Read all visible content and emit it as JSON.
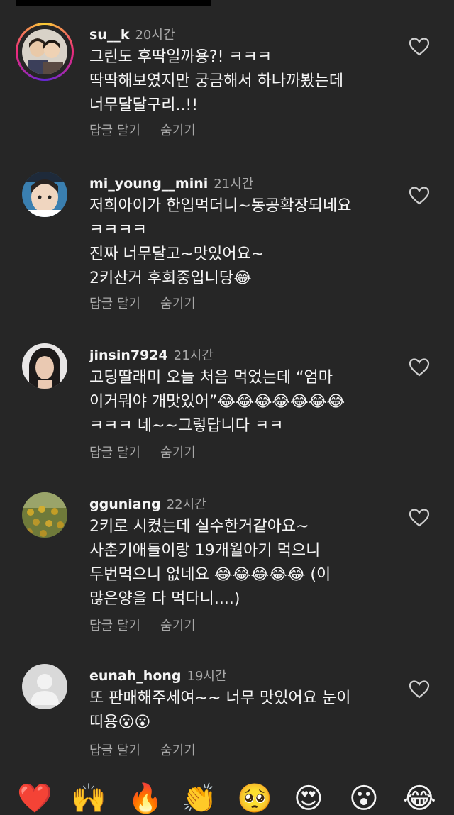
{
  "comments": [
    {
      "username": "su__k",
      "time": "20시간",
      "text": "그린도 후딱일까용?! ㅋㅋㅋ\n딱딱해보였지만 궁금해서 하나까봤는데\n너무달달구리..!!",
      "reply_label": "답글 달기",
      "hide_label": "숨기기"
    },
    {
      "username": "mi_young__mini",
      "time": "21시간",
      "text": "저희아이가 한입먹더니~동공확장되네요\nㅋㅋㅋㅋ\n진짜 너무달고~맛있어요~\n2키산거 후회중입니당😂",
      "reply_label": "답글 달기",
      "hide_label": "숨기기"
    },
    {
      "username": "jinsin7924",
      "time": "21시간",
      "text": "고딩딸래미 오늘 처음 먹었는데 “엄마\n이거뭐야 개맛있어”😂😂😂😂😂😂😂\nㅋㅋㅋ 네~~그렇답니다 ㅋㅋ",
      "reply_label": "답글 달기",
      "hide_label": "숨기기"
    },
    {
      "username": "gguniang",
      "time": "22시간",
      "text": "2키로 시켰는데 실수한거같아요~\n사춘기애들이랑 19개월아기 먹으니\n두번먹으니 없네요 😂😂😂😂😂 (이\n많은양을 다 먹다니....)",
      "reply_label": "답글 달기",
      "hide_label": "숨기기"
    },
    {
      "username": "eunah_hong",
      "time": "19시간",
      "text": "또 판매해주세여~~ 너무 맛있어요 눈이\n띠용😮😮",
      "reply_label": "답글 달기",
      "hide_label": "숨기기"
    }
  ],
  "quick_reactions": [
    "❤️",
    "🙌",
    "🔥",
    "👏",
    "🥺",
    "😍",
    "😮",
    "😂"
  ],
  "colors": {
    "background": "#262626",
    "text": "#f5f5f5",
    "secondary": "#a8a8a8"
  }
}
